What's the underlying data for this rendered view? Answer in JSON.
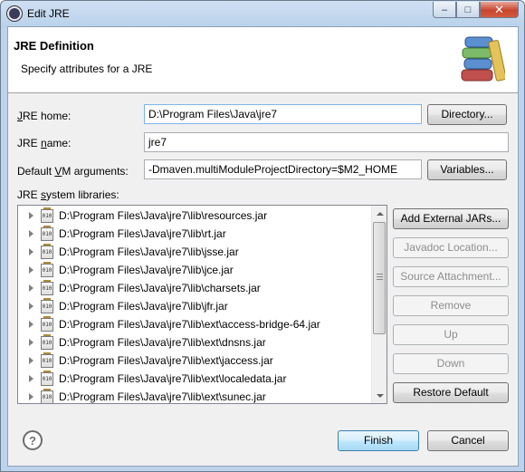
{
  "window": {
    "title": "Edit JRE"
  },
  "header": {
    "title": "JRE Definition",
    "subtitle": "Specify attributes for a JRE"
  },
  "form": {
    "jre_home_label": "JRE home:",
    "jre_home_value": "D:\\Program Files\\Java\\jre7",
    "directory_button": "Directory...",
    "jre_name_label": "JRE name:",
    "jre_name_value": "jre7",
    "vm_args_label": "Default VM arguments:",
    "vm_args_value": "-Dmaven.multiModuleProjectDirectory=$M2_HOME",
    "variables_button": "Variables...",
    "libraries_label": "JRE system libraries:"
  },
  "libraries": [
    "D:\\Program Files\\Java\\jre7\\lib\\resources.jar",
    "D:\\Program Files\\Java\\jre7\\lib\\rt.jar",
    "D:\\Program Files\\Java\\jre7\\lib\\jsse.jar",
    "D:\\Program Files\\Java\\jre7\\lib\\jce.jar",
    "D:\\Program Files\\Java\\jre7\\lib\\charsets.jar",
    "D:\\Program Files\\Java\\jre7\\lib\\jfr.jar",
    "D:\\Program Files\\Java\\jre7\\lib\\ext\\access-bridge-64.jar",
    "D:\\Program Files\\Java\\jre7\\lib\\ext\\dnsns.jar",
    "D:\\Program Files\\Java\\jre7\\lib\\ext\\jaccess.jar",
    "D:\\Program Files\\Java\\jre7\\lib\\ext\\localedata.jar",
    "D:\\Program Files\\Java\\jre7\\lib\\ext\\sunec.jar"
  ],
  "jar_icon_text": "010",
  "side_buttons": {
    "add_external_jars": "Add External JARs...",
    "javadoc_location": "Javadoc Location...",
    "source_attachment": "Source Attachment...",
    "remove": "Remove",
    "up": "Up",
    "down": "Down",
    "restore_default": "Restore Default"
  },
  "footer": {
    "help_glyph": "?",
    "finish": "Finish",
    "cancel": "Cancel"
  },
  "titlebar_buttons": {
    "minimize": "–",
    "maximize": "□",
    "close": "✕"
  }
}
